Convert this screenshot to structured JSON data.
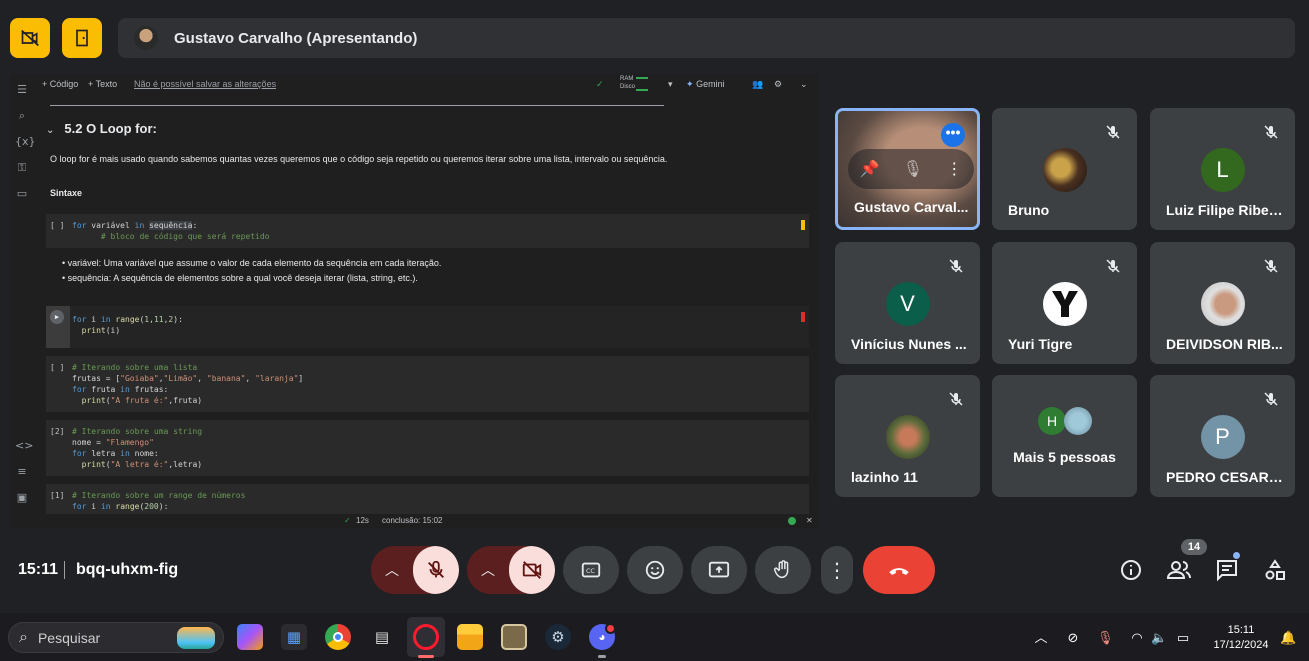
{
  "presenter": {
    "title": "Gustavo Carvalho (Apresentando)"
  },
  "colab": {
    "toolbar": {
      "add_code": "+ Código",
      "add_text": "+ Texto",
      "unsaved": "Não é possível salvar as alterações",
      "ram": "RAM",
      "disk": "Disco",
      "gemini": "Gemini"
    },
    "section_title": "5.2 O Loop for:",
    "paragraph": "O loop for é mais usado quando sabemos quantas vezes queremos que o código seja repetido ou queremos iterar sobre uma lista, intervalo ou sequência.",
    "syntax_label": "Sintaxe",
    "cell1": {
      "gutter": "[ ]"
    },
    "bullets": [
      "variável: Uma variável que assume o valor de cada elemento da sequência em cada iteração.",
      "sequência: A sequência de elementos sobre a qual você deseja iterar (lista, string, etc.)."
    ],
    "cell3": {
      "gutter": "[ ]"
    },
    "cell4": {
      "gutter": "[2]"
    },
    "cell5": {
      "gutter": "[1]"
    },
    "status": {
      "check": "✓",
      "elapsed": "12s",
      "completion": "conclusão: 15:02"
    }
  },
  "participants": [
    {
      "name": "Gustavo Carval...",
      "active": true
    },
    {
      "name": "Bruno"
    },
    {
      "name": "Luiz Filipe Ribei...",
      "initial": "L",
      "color": "#33691e"
    },
    {
      "name": "Vinícius Nunes ...",
      "initial": "V",
      "color": "#0b5e4a"
    },
    {
      "name": "Yuri Tigre"
    },
    {
      "name": "DEIVIDSON RIB..."
    },
    {
      "name": "lazinho 11"
    },
    {
      "name": "Mais 5 pessoas",
      "initial": "H"
    },
    {
      "name": "PEDRO CESAR ...",
      "initial": "P",
      "color": "#7393a7"
    }
  ],
  "meeting": {
    "time": "15:11",
    "code": "bqq-uhxm-fig",
    "people_count": "14"
  },
  "taskbar": {
    "search_placeholder": "Pesquisar",
    "time": "15:11",
    "date": "17/12/2024"
  },
  "colors": {
    "accent_yellow": "#fbbc04",
    "hangup_red": "#ea4335",
    "muted_bg": "#f9dedc",
    "active_border": "#8ab4f8"
  }
}
